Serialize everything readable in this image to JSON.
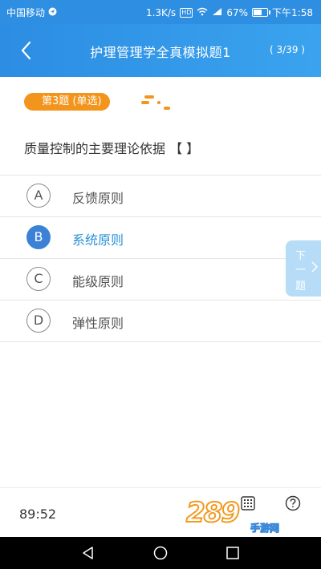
{
  "status_bar": {
    "carrier": "中国移动",
    "speed": "1.3K/s",
    "hd": "HD",
    "battery": "67%",
    "time": "下午1:58"
  },
  "header": {
    "title": "护理管理学全真模拟题1",
    "count": "( 3/39 )"
  },
  "question": {
    "tag": "第3题 (单选)",
    "text": "质量控制的主要理论依据 【 】"
  },
  "options": [
    {
      "letter": "A",
      "text": "反馈原则",
      "selected": false
    },
    {
      "letter": "B",
      "text": "系统原则",
      "selected": true
    },
    {
      "letter": "C",
      "text": "能级原则",
      "selected": false
    },
    {
      "letter": "D",
      "text": "弹性原则",
      "selected": false
    }
  ],
  "next_tab": {
    "l1": "下",
    "l2": "一",
    "l3": "题"
  },
  "bottom": {
    "timer": "89:52"
  },
  "watermark": {
    "num": "289",
    "text": "手游网"
  },
  "colors": {
    "primary": "#2e8ee2",
    "tag": "#f3951d",
    "selected": "#3b82d6"
  }
}
